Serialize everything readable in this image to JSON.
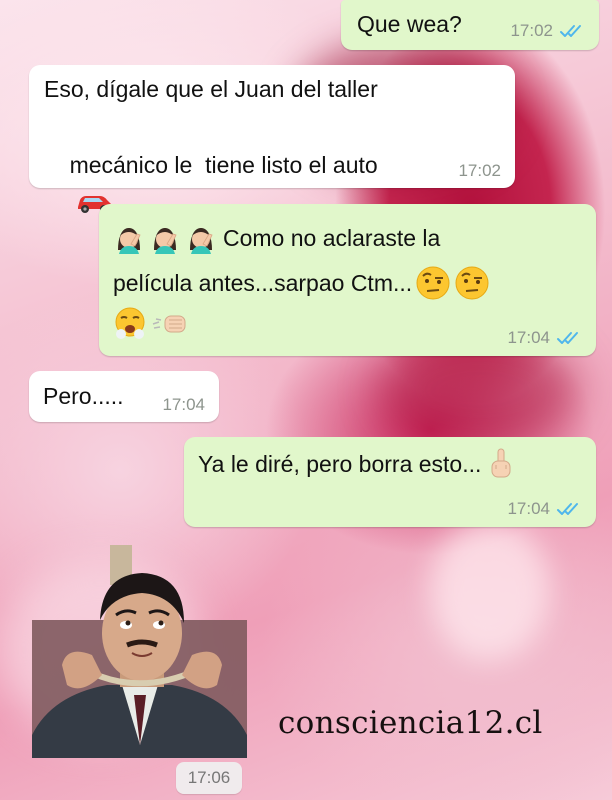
{
  "chat": {
    "messages": [
      {
        "direction": "outgoing",
        "text": "Que wea?",
        "time": "17:02",
        "status": "read"
      },
      {
        "direction": "incoming",
        "line1": "Eso, dígale que el Juan del taller",
        "line2": "mecánico le  tiene listo el auto",
        "time": "17:02",
        "emoji": [
          "red-car"
        ]
      },
      {
        "direction": "outgoing",
        "line1": "Como no aclaraste la",
        "line2": "película antes...sarpao Ctm...",
        "time": "17:04",
        "status": "read",
        "emoji": [
          "woman-facepalming",
          "woman-facepalming",
          "woman-facepalming",
          "face-with-raised-eyebrow",
          "face-with-raised-eyebrow",
          "face-with-steam",
          "fist-bump"
        ]
      },
      {
        "direction": "incoming",
        "text": "Pero.....",
        "time": "17:04"
      },
      {
        "direction": "outgoing",
        "text": "Ya le diré, pero borra esto...",
        "time": "17:04",
        "status": "read",
        "emoji": [
          "middle-finger"
        ]
      },
      {
        "direction": "incoming",
        "type": "sticker",
        "sticker": "man-with-noose",
        "time": "17:06"
      }
    ]
  },
  "watermark": "consciencia12.cl",
  "colors": {
    "outgoing_bubble": "#e1f7cb",
    "incoming_bubble": "#ffffff",
    "read_ticks": "#4fb6ec",
    "wallpaper_accent": "#c4254f"
  }
}
